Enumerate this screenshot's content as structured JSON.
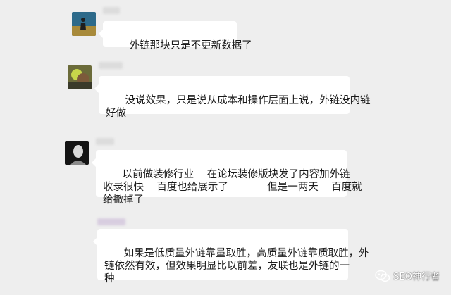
{
  "messages": [
    {
      "text": "外链那块只是不更新数据了"
    },
    {
      "text": "没说效果，只是说从成本和操作层面上说，外链没内链\n好做"
    },
    {
      "text": "以前做装修行业    在论坛装修版块发了内容加外链\n收录很快    百度也给展示了            但是一两天    百度就\n给撤掉了"
    },
    {
      "text": "如果是低质量外链靠量取胜，高质量外链靠质取胜，外\n链依然有效，但效果明显比以前差，友联也是外链的一\n种"
    }
  ],
  "watermark": {
    "text": "SEO神行者",
    "icon": "wechat-icon"
  },
  "colors": {
    "background": "#eeeeee",
    "bubble": "#ffffff",
    "text": "#1a1a1a"
  }
}
